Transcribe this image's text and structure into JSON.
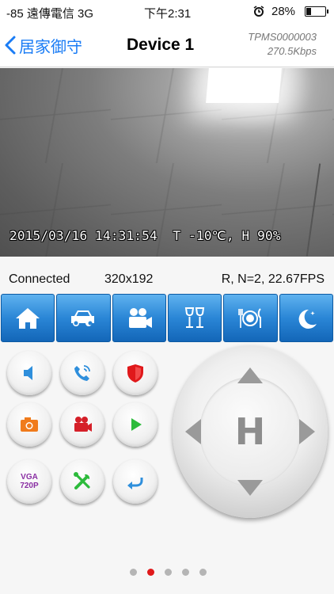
{
  "status_bar": {
    "carrier": "-85 遠傳電信  3G",
    "time": "下午2:31",
    "battery": "28%",
    "battery_level": 0.28
  },
  "nav": {
    "back_label": "居家御守",
    "title": "Device 1",
    "device_id": "TPMS0000003",
    "bitrate": "270.5Kbps"
  },
  "video": {
    "overlay": "2015/03/16 14:31:54  T -10℃, H 90%"
  },
  "info": {
    "status": "Connected",
    "resolution": "320x192",
    "stats": "R, N=2, 22.67FPS"
  },
  "modes": [
    "home-icon",
    "car-icon",
    "video-camera-icon",
    "wine-glasses-icon",
    "dining-icon",
    "night-moon-icon"
  ],
  "controls": {
    "vga_line1": "VGA",
    "vga_line2": "720P",
    "home_label": "H"
  },
  "pager": {
    "total": 5,
    "active_index": 1
  },
  "colors": {
    "accent": "#1a7cf5",
    "toolbar": "#2a86d6",
    "red": "#e0191b",
    "orange": "#f07b1c",
    "green": "#2dbb3c",
    "purple": "#8a2fa3"
  }
}
